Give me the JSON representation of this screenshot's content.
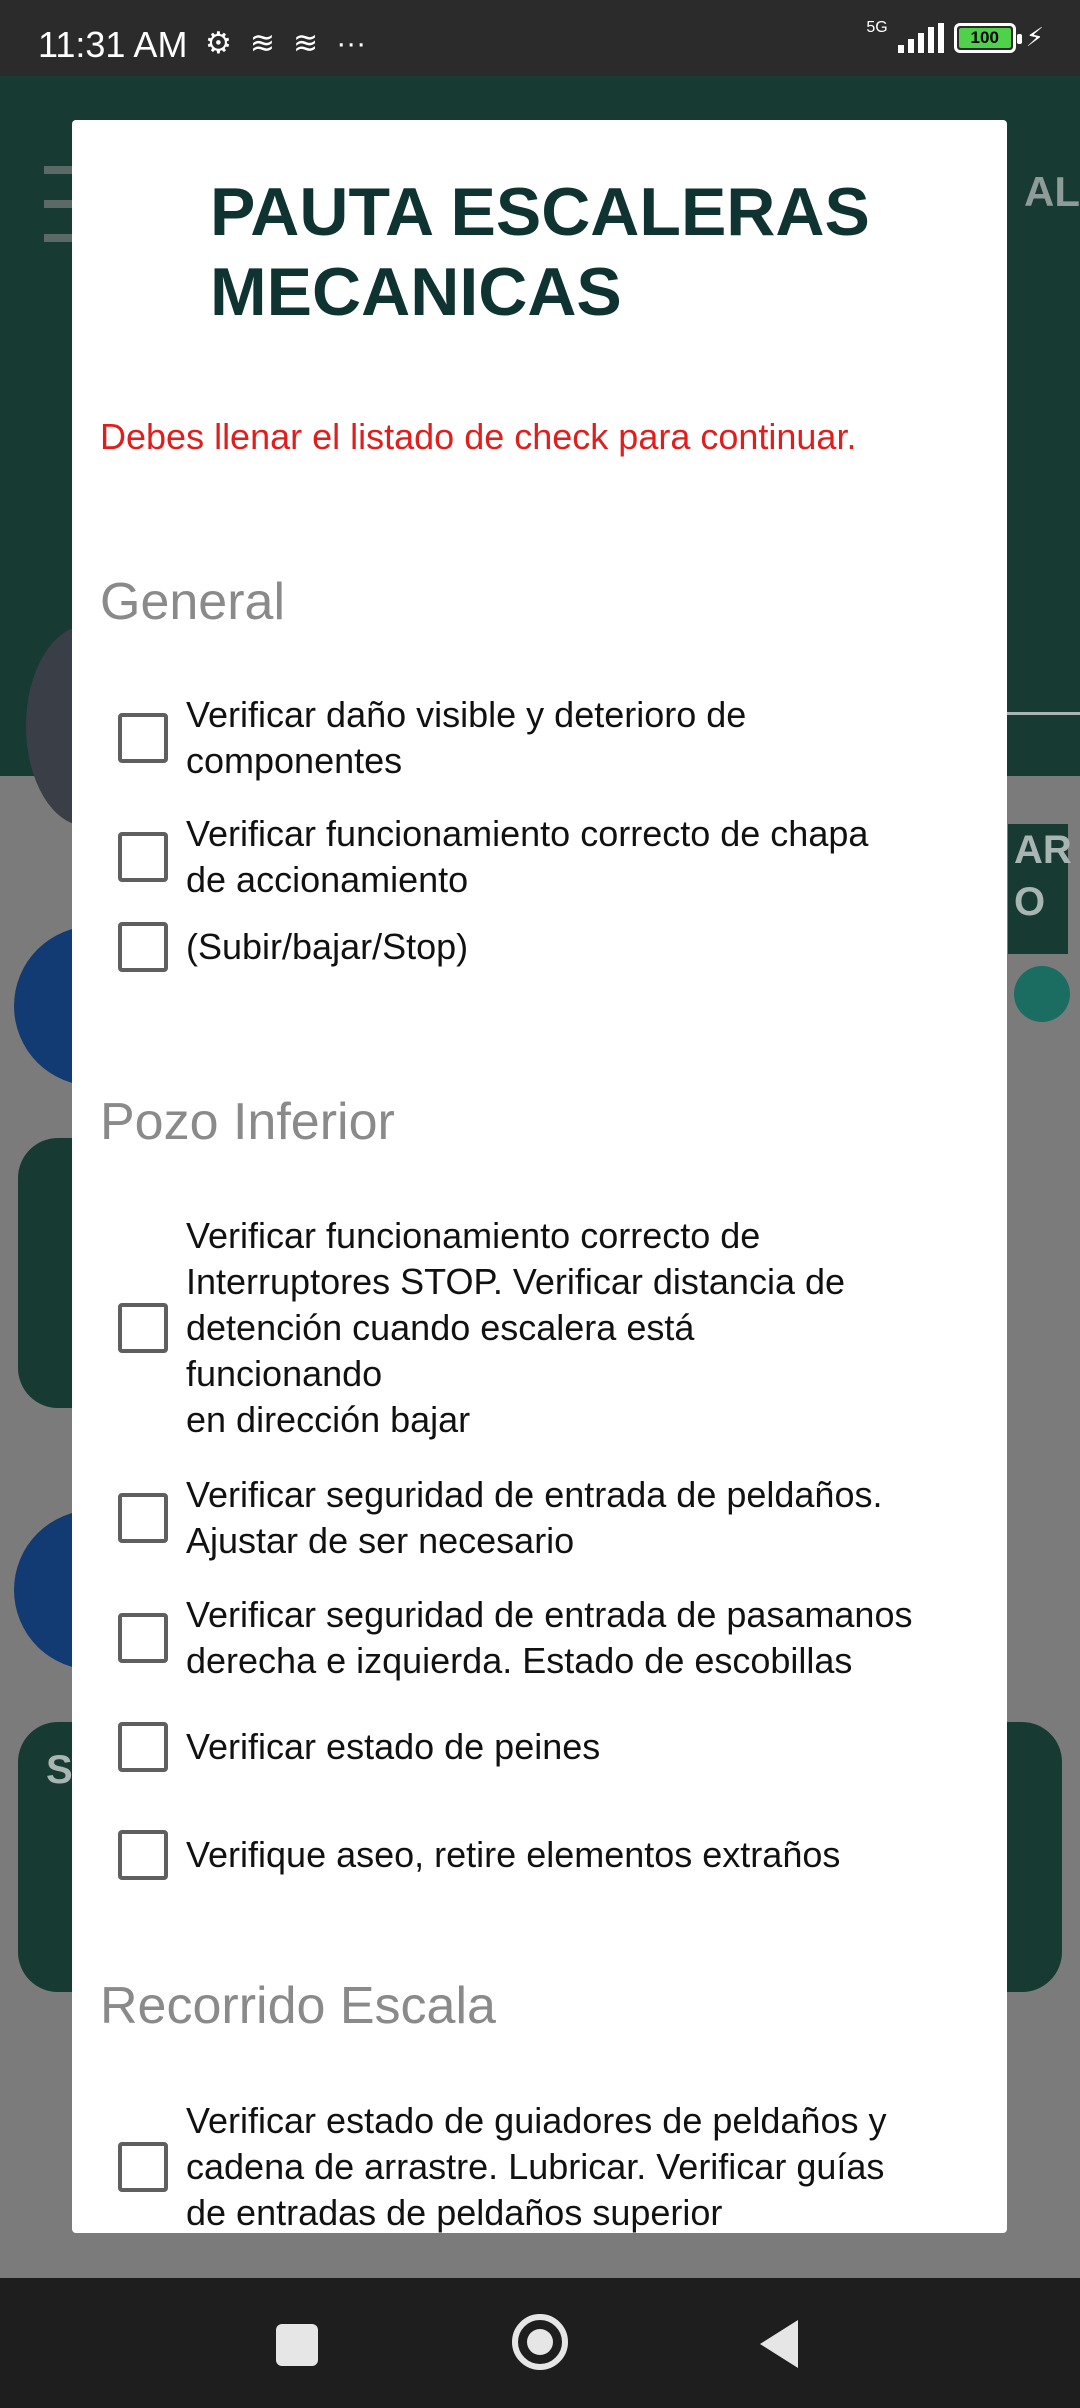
{
  "status_bar": {
    "time": "11:31 AM",
    "network": "5G",
    "battery": "100",
    "icons": [
      "settings-icon",
      "layers-icon",
      "layers-icon",
      "more-icon",
      "signal-icon",
      "battery-icon",
      "charging-icon"
    ]
  },
  "background": {
    "right_text": "AL",
    "right_button": "AR\nO",
    "s_letter": "S"
  },
  "dialog": {
    "title": "PAUTA ESCALERAS MECANICAS",
    "warning": "Debes llenar el listado de check para continuar.",
    "sections": [
      {
        "title": "General",
        "items": [
          "Verificar daño visible y deterioro de\ncomponentes",
          "Verificar funcionamiento correcto de chapa\nde accionamiento",
          "(Subir/bajar/Stop)"
        ]
      },
      {
        "title": "Pozo Inferior",
        "items": [
          "Verificar funcionamiento correcto de\nInterruptores STOP. Verificar distancia de\ndetención cuando escalera está\nfuncionando\nen dirección bajar",
          "Verificar seguridad de entrada de peldaños.\nAjustar de ser necesario",
          "Verificar seguridad de entrada de pasamanos\nderecha e izquierda. Estado de escobillas",
          "Verificar estado de peines",
          "Verifique aseo, retire elementos extraños"
        ]
      },
      {
        "title": "Recorrido Escala",
        "items": [
          "Verificar estado de guiadores de peldaños y\ncadena de arrastre. Lubricar. Verificar guías\nde entradas de peldaños superior"
        ]
      }
    ]
  },
  "colors": {
    "title": "#0f3330",
    "warning": "#e01e1e",
    "section": "#8a8a8a",
    "header_bg": "#173a33"
  }
}
